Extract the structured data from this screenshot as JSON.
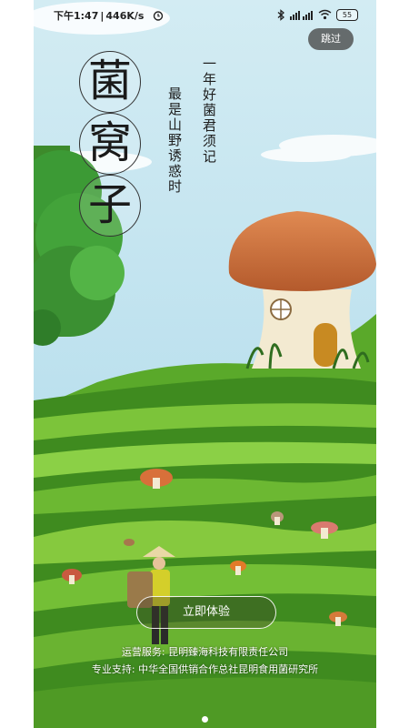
{
  "status_bar": {
    "time": "下午1:47",
    "network_speed": "446K/s",
    "battery_level": "55",
    "icons": [
      "alarm-icon",
      "bluetooth-icon",
      "signal-icon",
      "wifi-icon",
      "battery-icon"
    ]
  },
  "skip_label": "跳过",
  "logo_chars": [
    "菌",
    "窝",
    "子"
  ],
  "slogans": [
    "一年好菌君须记",
    "最是山野诱惑时"
  ],
  "enter_label": "立即体验",
  "credits": {
    "operator": "运营服务: 昆明臻海科技有限责任公司",
    "support": "专业支持: 中华全国供销合作总社昆明食用菌研究所"
  },
  "colors": {
    "sky_top": "#d3ecf3",
    "grass_dark": "#3f8b1f",
    "grass_light": "#7cc43a",
    "mushroom_cap": "#cf6f3d",
    "button_bg": "#474747"
  }
}
